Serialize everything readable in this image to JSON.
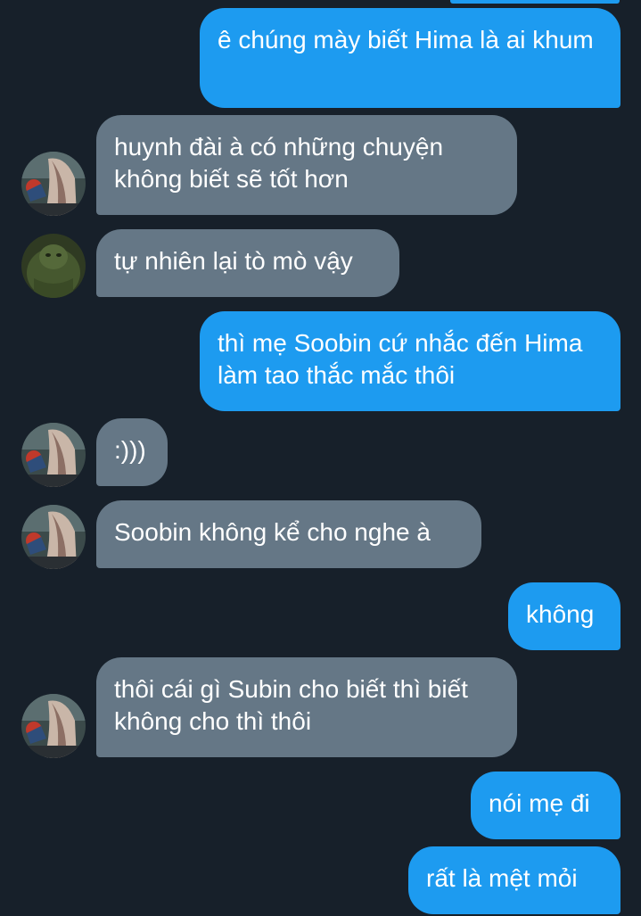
{
  "conversation": {
    "messages": [
      {
        "side": "sent",
        "text": "ê chúng mày biết Hima là  ai khum"
      },
      {
        "side": "received",
        "avatar": "anime-character-avatar",
        "text": "huynh đài à có những chuyện không biết sẽ tốt hơn"
      },
      {
        "side": "received",
        "avatar": "green-creature-avatar",
        "text": "tự nhiên lại tò mò vậy"
      },
      {
        "side": "sent",
        "text": "thì mẹ Soobin cứ nhắc đến Hima làm tao thắc mắc thôi"
      },
      {
        "side": "received",
        "avatar": "anime-character-avatar",
        "text": ":)))"
      },
      {
        "side": "received",
        "avatar": "anime-character-avatar",
        "text": "Soobin không kể cho nghe à"
      },
      {
        "side": "sent",
        "text": "không"
      },
      {
        "side": "received",
        "avatar": "anime-character-avatar",
        "text": "thôi cái gì Subin cho biết thì biết không cho thì thôi"
      },
      {
        "side": "sent",
        "text": "nói mẹ đi"
      },
      {
        "side": "sent",
        "text": "rất là mệt mỏi"
      }
    ]
  },
  "colors": {
    "background": "#17202a",
    "sent_bubble": "#1d9bf0",
    "received_bubble": "#657786",
    "text": "#ffffff"
  }
}
